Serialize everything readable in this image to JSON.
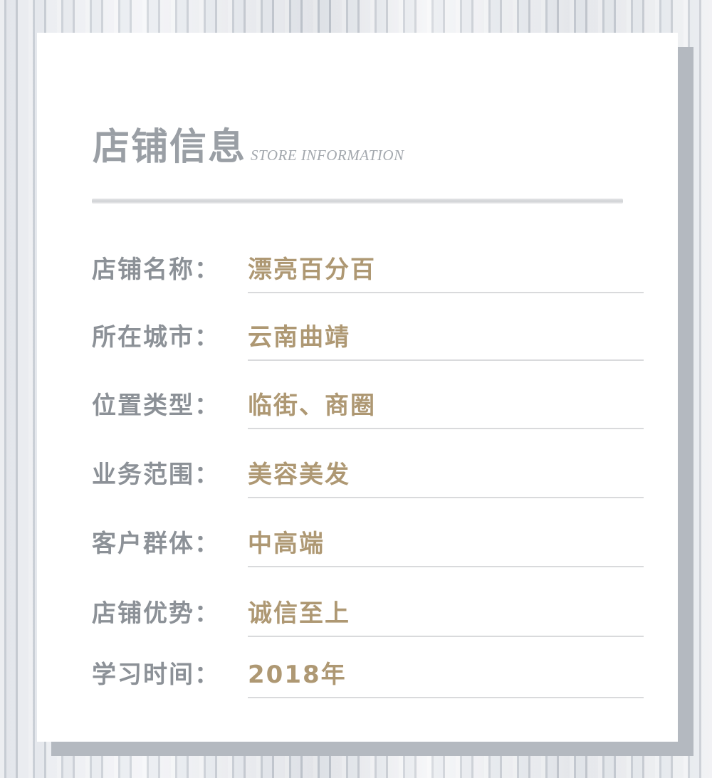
{
  "header": {
    "title": "店铺信息",
    "subtitle": "STORE  INFORMATION"
  },
  "rows": [
    {
      "label": "店铺名称：",
      "value": "漂亮百分百"
    },
    {
      "label": "所在城市：",
      "value": "云南曲靖"
    },
    {
      "label": "位置类型：",
      "value": "临街、商圈"
    },
    {
      "label": "业务范围：",
      "value": "美容美发"
    },
    {
      "label": "客户群体：",
      "value": "中高端"
    },
    {
      "label": "店铺优势：",
      "value": "诚信至上"
    },
    {
      "label": "学习时间：",
      "value": "2018年"
    }
  ],
  "colors": {
    "label": "#8c9197",
    "value": "#ae9873",
    "title": "#9a9fa5"
  }
}
